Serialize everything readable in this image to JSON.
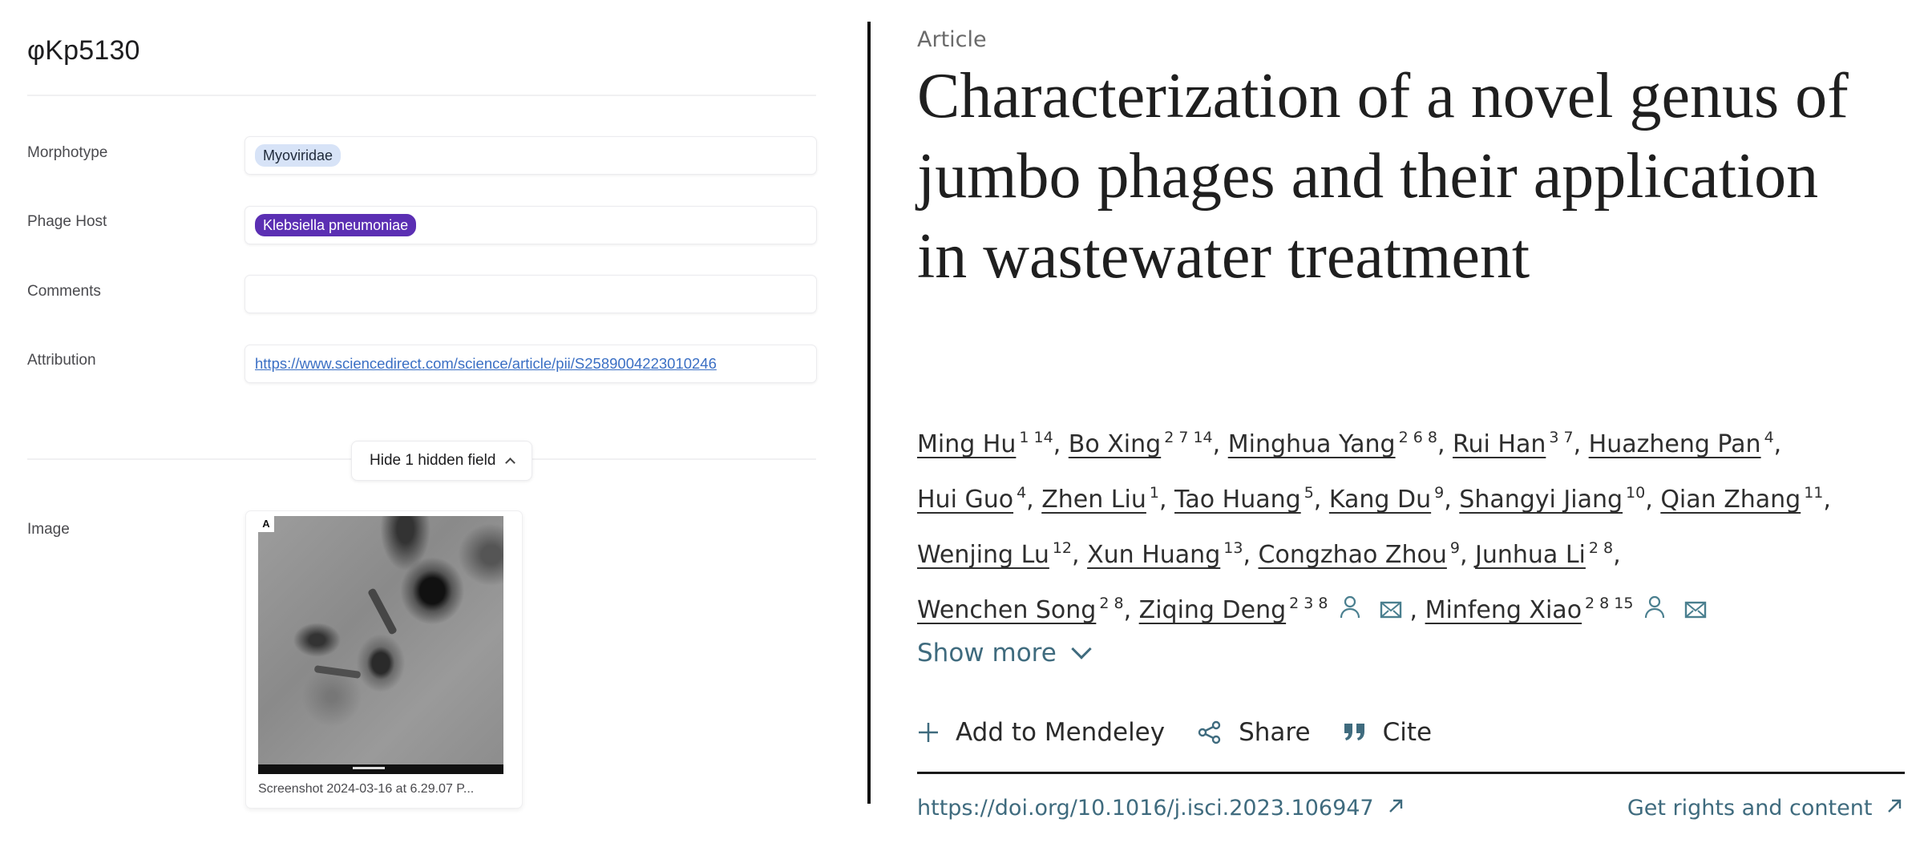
{
  "record": {
    "title": "φKp5130",
    "fields": {
      "morphotype": {
        "label": "Morphotype",
        "value": "Myoviridae"
      },
      "phage_host": {
        "label": "Phage Host",
        "value": "Klebsiella pneumoniae"
      },
      "comments": {
        "label": "Comments",
        "value": ""
      },
      "attribution": {
        "label": "Attribution",
        "value": "https://www.sciencedirect.com/science/article/pii/S2589004223010246"
      },
      "image": {
        "label": "Image",
        "caption": "Screenshot 2024-03-16 at 6.29.07 P...",
        "panel_letter": "A"
      }
    },
    "hide_hidden_button": "Hide 1 hidden field",
    "colors": {
      "morphotype_tag_bg": "#d7e3f7",
      "host_tag_bg": "#5b2fb3",
      "link": "#3a6fc4"
    }
  },
  "article": {
    "type": "Article",
    "title": "Characterization of a novel genus of jumbo phages and their application in wastewater treatment",
    "authors": [
      {
        "name": "Ming Hu",
        "aff": "1 14"
      },
      {
        "name": "Bo Xing",
        "aff": "2 7 14"
      },
      {
        "name": "Minghua Yang",
        "aff": "2 6 8"
      },
      {
        "name": "Rui Han",
        "aff": "3 7"
      },
      {
        "name": "Huazheng Pan",
        "aff": "4"
      },
      {
        "name": "Hui Guo",
        "aff": "4"
      },
      {
        "name": "Zhen Liu",
        "aff": "1"
      },
      {
        "name": "Tao Huang",
        "aff": "5"
      },
      {
        "name": "Kang Du",
        "aff": "9"
      },
      {
        "name": "Shangyi Jiang",
        "aff": "10"
      },
      {
        "name": "Qian Zhang",
        "aff": "11"
      },
      {
        "name": "Wenjing Lu",
        "aff": "12"
      },
      {
        "name": "Xun Huang",
        "aff": "13"
      },
      {
        "name": "Congzhao Zhou",
        "aff": "9"
      },
      {
        "name": "Junhua Li",
        "aff": "2 8"
      },
      {
        "name": "Wenchen Song",
        "aff": "2 8"
      },
      {
        "name": "Ziqing Deng",
        "aff": "2 3 8",
        "icons": [
          "person-icon",
          "envelope-icon"
        ]
      },
      {
        "name": "Minfeng Xiao",
        "aff": "2 8 15",
        "icons": [
          "person-icon",
          "envelope-icon"
        ]
      }
    ],
    "show_more": "Show more",
    "actions": {
      "mendeley": "Add to Mendeley",
      "share": "Share",
      "cite": "Cite"
    },
    "doi": "https://doi.org/10.1016/j.isci.2023.106947",
    "rights": "Get rights and content",
    "colors": {
      "accent": "#3f6b7e",
      "icon": "#4a7f8f"
    }
  }
}
